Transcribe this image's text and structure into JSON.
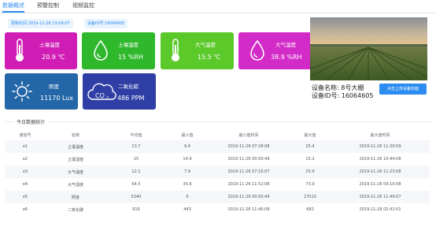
{
  "tabs": [
    {
      "label": "数据概述",
      "active": true
    },
    {
      "label": "预警控制",
      "active": false
    },
    {
      "label": "视频监控",
      "active": false
    }
  ],
  "info": {
    "update_time": "更新时间  2019-11-26 13:09:07",
    "device_id": "设备ID号  16064605"
  },
  "cards": [
    {
      "name": "土壤温度",
      "value": "20.9 ℃",
      "color": "#d01db5",
      "icon": "thermometer-icon"
    },
    {
      "name": "土壤湿度",
      "value": "15 %RH",
      "color": "#2fb82c",
      "icon": "water-drop-icon"
    },
    {
      "name": "大气温度",
      "value": "15.5 ℃",
      "color": "#5cc92b",
      "icon": "thermometer-icon"
    },
    {
      "name": "大气湿度",
      "value": "38.9 %RH",
      "color": "#d32bc8",
      "icon": "water-drop-icon"
    },
    {
      "name": "照度",
      "value": "11170 Lux",
      "color": "#2367a8",
      "icon": "sun-icon"
    },
    {
      "name": "二氧化碳",
      "value": "486 PPM",
      "color": "#2f3fa5",
      "icon": "co2-cloud-icon"
    }
  ],
  "device": {
    "name_line": "设备名称: 8号大棚",
    "id_line": "设备ID号: 16064605",
    "upload_label": "点击上传设备封面"
  },
  "stats": {
    "title": "今日数据统计",
    "headers": [
      "通道号",
      "名称",
      "平均值",
      "最小值",
      "最小值时间",
      "最大值",
      "最大值时间"
    ],
    "rows": [
      [
        "e1",
        "土壤温度",
        "13.7",
        "9.4",
        "2019-11-26 07:28:08",
        "25.4",
        "2019-11-26 11:30:09"
      ],
      [
        "e2",
        "土壤湿度",
        "15",
        "14.9",
        "2019-11-26 00:00:49",
        "15.2",
        "2019-11-26 10:44:08"
      ],
      [
        "e3",
        "大气温度",
        "12.1",
        "7.9",
        "2019-11-26 07:16:07",
        "25.9",
        "2019-11-26 11:23:08"
      ],
      [
        "e4",
        "大气湿度",
        "64.5",
        "35.6",
        "2019-11-26 11:52:08",
        "73.9",
        "2019-11-26 09:10:08"
      ],
      [
        "e5",
        "照度",
        "5340",
        "0",
        "2019-11-26 00:00:49",
        "27010",
        "2019-11-26 11:49:07"
      ],
      [
        "e6",
        "二氧化碳",
        "616",
        "443",
        "2019-11-26 11:46:08",
        "682",
        "2019-11-26 02:42:01"
      ]
    ]
  }
}
